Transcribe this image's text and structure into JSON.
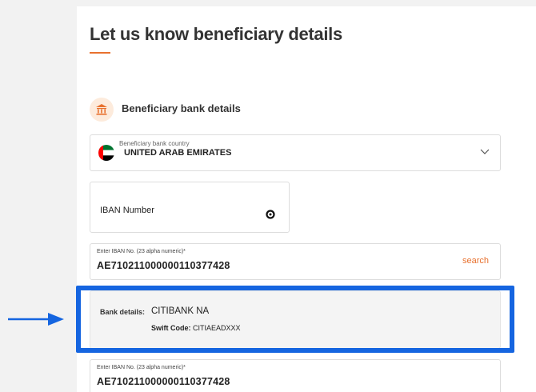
{
  "page": {
    "title": "Let us know beneficiary details"
  },
  "section": {
    "title": "Beneficiary bank details",
    "icon": "bank-icon"
  },
  "country": {
    "label": "Beneficiary bank country",
    "value": "UNITED ARAB EMIRATES",
    "flag": "uae-flag-icon"
  },
  "iban_option": {
    "label": "IBAN Number",
    "selected": true
  },
  "iban_input": {
    "label": "Enter IBAN No. (23 alpha numeric)*",
    "value": "AE710211000000110377428",
    "search_label": "search"
  },
  "bank_details": {
    "label": "Bank details:",
    "bank_name": "CITIBANK NA",
    "swift_label": "Swift Code:",
    "swift_value": "CITIAEADXXX"
  },
  "iban_input_2": {
    "label": "Enter IBAN No. (23 alpha numeric)*",
    "value": "AE710211000000110377428"
  },
  "colors": {
    "accent": "#e8712e",
    "highlight": "#1565e0"
  }
}
